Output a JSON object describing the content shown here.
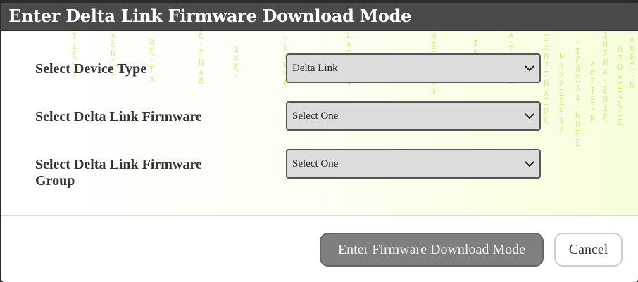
{
  "dialog": {
    "title": "Enter Delta Link Firmware Download Mode"
  },
  "fields": [
    {
      "label": "Select Device Type",
      "value": "Delta Link"
    },
    {
      "label": "Select Delta Link Firmware",
      "value": "Select One"
    },
    {
      "label_line1": "Select Delta Link Firmware",
      "label_line2": "Group",
      "value": "Select One"
    }
  ],
  "buttons": {
    "enter_label": "Enter Firmware Download Mode",
    "cancel_label": "Cancel"
  },
  "icons": {
    "dropdown": "chevron-down-icon"
  },
  "colors": {
    "titlebar": "#4a4a4a",
    "primary_button": "#7f7f7f",
    "select_background": "#dcdcdc",
    "decoration": "#c8ec6a"
  }
}
